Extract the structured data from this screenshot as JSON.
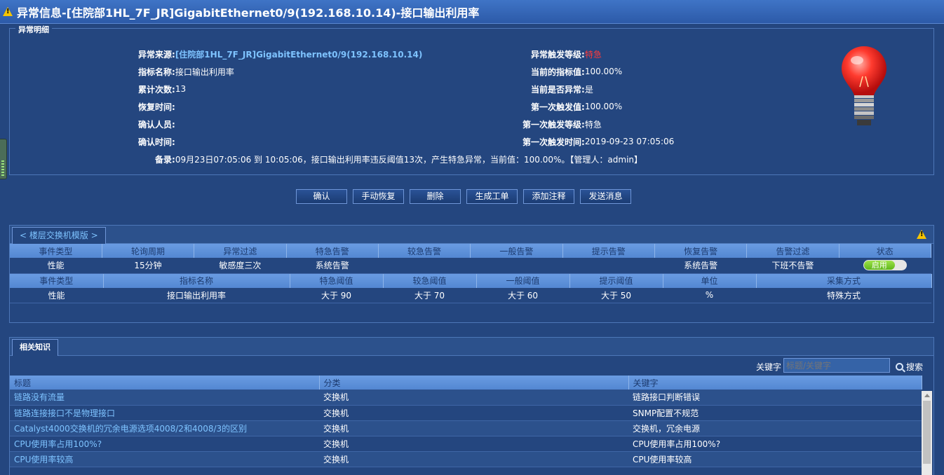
{
  "window": {
    "title": "异常信息-[住院部1HL_7F_JR]GigabitEthernet0/9(192.168.10.14)-接口输出利用率"
  },
  "detail": {
    "legend": "异常明细",
    "source_label": "异常来源:",
    "source_value": "[住院部1HL_7F_JR]GigabitEthernet0/9(192.168.10.14)",
    "metric_label": "指标名称:",
    "metric_value": "接口输出利用率",
    "count_label": "累计次数:",
    "count_value": "13",
    "recover_label": "恢复时间:",
    "recover_value": "",
    "confirm_user_label": "确认人员:",
    "confirm_user_value": "",
    "confirm_time_label": "确认时间:",
    "confirm_time_value": "",
    "level_label": "异常触发等级:",
    "level_value": "特急",
    "current_value_label": "当前的指标值:",
    "current_value": "100.00%",
    "is_abnormal_label": "当前是否异常:",
    "is_abnormal_value": "是",
    "first_value_label": "第一次触发值:",
    "first_value": "100.00%",
    "first_level_label": "第一次触发等级:",
    "first_level_value": "特急",
    "first_time_label": "第一次触发时间:",
    "first_time_value": "2019-09-23 07:05:06",
    "remark_label": "备录:",
    "remark_value": "09月23日07:05:06 到 10:05:06，接口输出利用率违反阈值13次，产生特急异常，当前值：100.00%。【管理人：admin】"
  },
  "actions": {
    "confirm": "确认",
    "manual_recover": "手动恢复",
    "delete": "删除",
    "create_ticket": "生成工单",
    "add_note": "添加注释",
    "send_message": "发送消息"
  },
  "template": {
    "tab": "< 楼层交换机模版 >",
    "headers1": [
      "事件类型",
      "轮询周期",
      "异常过滤",
      "特急告警",
      "较急告警",
      "一般告警",
      "提示告警",
      "恢复告警",
      "告警过滤",
      "状态"
    ],
    "row1": [
      "性能",
      "15分钟",
      "敏感度三次",
      "系统告警",
      "",
      "",
      "",
      "系统告警",
      "下班不告警"
    ],
    "status_toggle": "启用",
    "headers2": [
      "事件类型",
      "指标名称",
      "特急阈值",
      "较急阈值",
      "一般阈值",
      "提示阈值",
      "单位",
      "采集方式"
    ],
    "row2": [
      "性能",
      "接口输出利用率",
      "大于 90",
      "大于 70",
      "大于 60",
      "大于 50",
      "%",
      "特殊方式"
    ]
  },
  "knowledge": {
    "tab": "相关知识",
    "keyword_label": "关键字",
    "keyword_placeholder": "标题/关键字",
    "search_button": "搜索",
    "headers": [
      "标题",
      "分类",
      "关键字"
    ],
    "rows": [
      [
        "链路没有流量",
        "交换机",
        "链路接口判断错误"
      ],
      [
        "链路连接接口不是物理接口",
        "交换机",
        "SNMP配置不规范"
      ],
      [
        "Catalyst4000交换机的冗余电源选项4008/2和4008/3的区别",
        "交换机",
        "交换机，冗余电源"
      ],
      [
        "CPU使用率占用100%?",
        "交换机",
        "CPU使用率占用100%?"
      ],
      [
        "CPU使用率较高",
        "交换机",
        "CPU使用率较高"
      ]
    ]
  },
  "colors": {
    "background": "#24467f",
    "titlebar": "#3f74c6",
    "link": "#7ec3ff",
    "urgent": "#ff3b3b",
    "toggle_on": "#6cc020"
  }
}
